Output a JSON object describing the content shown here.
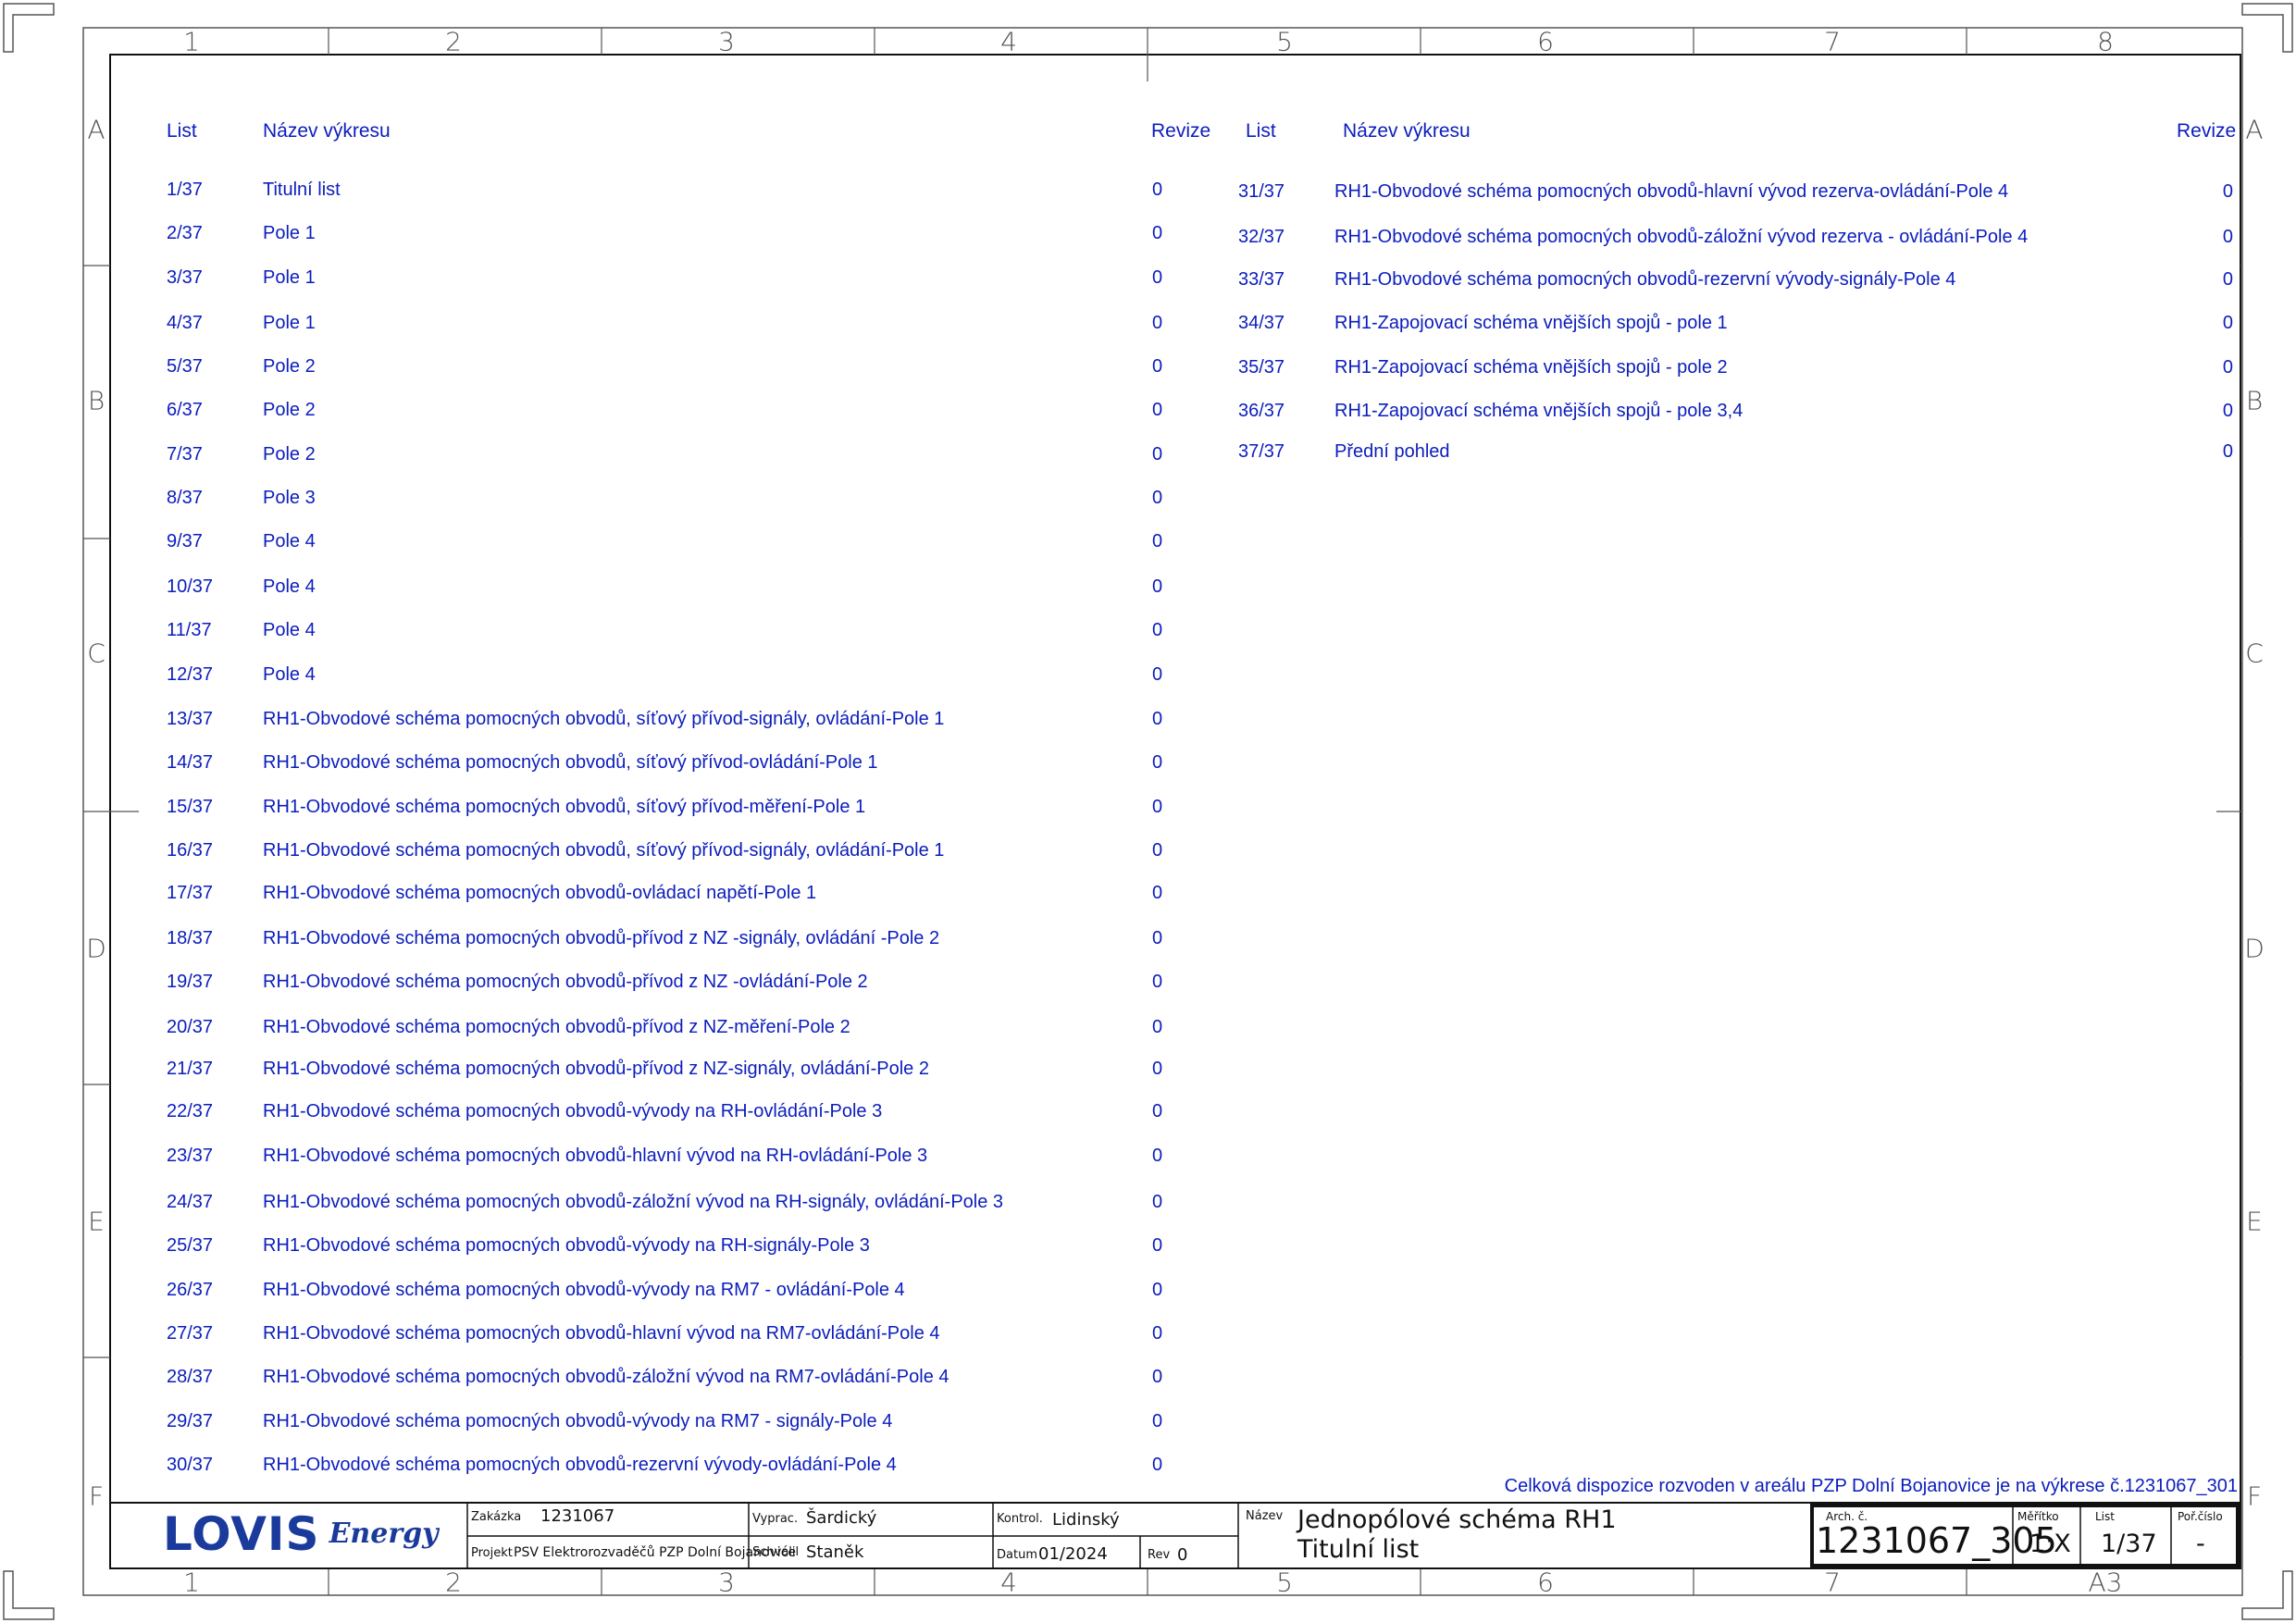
{
  "frame": {
    "columns": [
      "1",
      "2",
      "3",
      "4",
      "5",
      "6",
      "7",
      "8"
    ],
    "rows": [
      "A",
      "B",
      "C",
      "D",
      "E",
      "F"
    ],
    "bottom_columns": [
      "1",
      "2",
      "3",
      "4",
      "5",
      "6",
      "7",
      "A3"
    ]
  },
  "index": {
    "headers": {
      "list": "List",
      "name": "Název výkresu",
      "revision": "Revize"
    },
    "left": [
      {
        "list": "1/37",
        "name": "Titulní list",
        "rev": "0"
      },
      {
        "list": "2/37",
        "name": "Pole 1",
        "rev": "0"
      },
      {
        "list": "3/37",
        "name": "Pole 1",
        "rev": "0"
      },
      {
        "list": "4/37",
        "name": "Pole 1",
        "rev": "0"
      },
      {
        "list": "5/37",
        "name": "Pole 2",
        "rev": "0"
      },
      {
        "list": "6/37",
        "name": "Pole 2",
        "rev": "0"
      },
      {
        "list": "7/37",
        "name": "Pole 2",
        "rev": "0"
      },
      {
        "list": "8/37",
        "name": "Pole 3",
        "rev": "0"
      },
      {
        "list": "9/37",
        "name": "Pole 4",
        "rev": "0"
      },
      {
        "list": "10/37",
        "name": "Pole 4",
        "rev": "0"
      },
      {
        "list": "11/37",
        "name": "Pole 4",
        "rev": "0"
      },
      {
        "list": "12/37",
        "name": "Pole 4",
        "rev": "0"
      },
      {
        "list": "13/37",
        "name": "RH1-Obvodové schéma pomocných obvodů, síťový přívod-signály, ovládání-Pole 1",
        "rev": "0"
      },
      {
        "list": "14/37",
        "name": "RH1-Obvodové schéma pomocných obvodů, síťový přívod-ovládání-Pole 1",
        "rev": "0"
      },
      {
        "list": "15/37",
        "name": "RH1-Obvodové schéma pomocných obvodů, síťový přívod-měření-Pole 1",
        "rev": "0"
      },
      {
        "list": "16/37",
        "name": "RH1-Obvodové schéma pomocných obvodů, síťový přívod-signály, ovládání-Pole 1",
        "rev": "0"
      },
      {
        "list": "17/37",
        "name": "RH1-Obvodové schéma pomocných obvodů-ovládací napětí-Pole 1",
        "rev": "0"
      },
      {
        "list": "18/37",
        "name": "RH1-Obvodové schéma pomocných obvodů-přívod z NZ -signály, ovládání -Pole 2",
        "rev": "0"
      },
      {
        "list": "19/37",
        "name": "RH1-Obvodové schéma pomocných obvodů-přívod z NZ -ovládání-Pole 2",
        "rev": "0"
      },
      {
        "list": "20/37",
        "name": "RH1-Obvodové schéma pomocných obvodů-přívod z NZ-měření-Pole 2",
        "rev": "0"
      },
      {
        "list": "21/37",
        "name": "RH1-Obvodové schéma pomocných obvodů-přívod z NZ-signály, ovládání-Pole 2",
        "rev": "0"
      },
      {
        "list": "22/37",
        "name": "RH1-Obvodové schéma pomocných obvodů-vývody na RH-ovládání-Pole 3",
        "rev": "0"
      },
      {
        "list": "23/37",
        "name": "RH1-Obvodové schéma pomocných obvodů-hlavní vývod na RH-ovládání-Pole 3",
        "rev": "0"
      },
      {
        "list": "24/37",
        "name": "RH1-Obvodové schéma pomocných obvodů-záložní vývod na RH-signály, ovládání-Pole 3",
        "rev": "0"
      },
      {
        "list": "25/37",
        "name": "RH1-Obvodové schéma pomocných obvodů-vývody na RH-signály-Pole 3",
        "rev": "0"
      },
      {
        "list": "26/37",
        "name": "RH1-Obvodové schéma pomocných obvodů-vývody na RM7 - ovládání-Pole 4",
        "rev": "0"
      },
      {
        "list": "27/37",
        "name": "RH1-Obvodové schéma pomocných obvodů-hlavní vývod na RM7-ovládání-Pole 4",
        "rev": "0"
      },
      {
        "list": "28/37",
        "name": "RH1-Obvodové schéma pomocných obvodů-záložní vývod na RM7-ovládání-Pole 4",
        "rev": "0"
      },
      {
        "list": "29/37",
        "name": "RH1-Obvodové schéma pomocných obvodů-vývody na RM7 - signály-Pole 4",
        "rev": "0"
      },
      {
        "list": "30/37",
        "name": "RH1-Obvodové schéma pomocných obvodů-rezervní vývody-ovládání-Pole 4",
        "rev": "0"
      }
    ],
    "right": [
      {
        "list": "31/37",
        "name": "RH1-Obvodové schéma pomocných obvodů-hlavní vývod rezerva-ovládání-Pole 4",
        "rev": "0"
      },
      {
        "list": "32/37",
        "name": "RH1-Obvodové schéma pomocných obvodů-záložní vývod rezerva - ovládání-Pole 4",
        "rev": "0"
      },
      {
        "list": "33/37",
        "name": "RH1-Obvodové schéma pomocných obvodů-rezervní vývody-signály-Pole 4",
        "rev": "0"
      },
      {
        "list": "34/37",
        "name": "RH1-Zapojovací schéma vnějších spojů - pole 1",
        "rev": "0"
      },
      {
        "list": "35/37",
        "name": "RH1-Zapojovací schéma vnějších spojů - pole 2",
        "rev": "0"
      },
      {
        "list": "36/37",
        "name": "RH1-Zapojovací schéma vnějších spojů - pole 3,4",
        "rev": "0"
      },
      {
        "list": "37/37",
        "name": "Přední pohled",
        "rev": "0"
      }
    ],
    "note": "Celková dispozice rozvoden v areálu PZP Dolní Bojanovice je na výkrese č.1231067_301"
  },
  "title_block": {
    "logo_main": "LOVIS",
    "logo_sub": "Energy",
    "zakazka_label": "Zakázka",
    "zakazka_value": "1231067",
    "projekt_label": "Projekt",
    "projekt_value": "PSV Elektrorozvaděčů PZP Dolní Bojanovice",
    "vyprac_label": "Vyprac.",
    "vyprac_value": "Šardický",
    "schvalil_label": "Schválil",
    "schvalil_value": "Staněk",
    "kontrol_label": "Kontrol.",
    "kontrol_value": "Lidinský",
    "datum_label": "Datum",
    "datum_value": "01/2024",
    "rev_label": "Rev",
    "rev_value": "0",
    "nazev_label": "Název",
    "nazev_line1": "Jednopólové schéma RH1",
    "nazev_line2": "Titulní list",
    "arch_label": "Arch. č.",
    "arch_value": "1231067_305",
    "meritko_label": "Měřítko",
    "meritko_value": "1:X",
    "list_label": "List",
    "list_value": "1/37",
    "porcislo_label": "Poř.číslo",
    "porcislo_value": "-"
  },
  "colors": {
    "text": "#0b1dbd",
    "frame": "#555555",
    "logo_blue": "#1a3a9c",
    "logo_green": "#6cc04a"
  }
}
